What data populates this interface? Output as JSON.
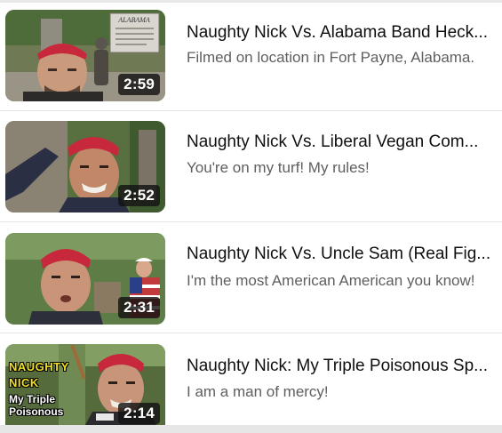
{
  "videos": [
    {
      "title": "Naughty Nick Vs. Alabama Band Heck...",
      "description": "Filmed on location in Fort Payne, Alabama.",
      "duration": "2:59",
      "thumb_sign": "ALABAMA"
    },
    {
      "title": "Naughty Nick Vs. Liberal Vegan Com...",
      "description": "You're on my turf! My rules!",
      "duration": "2:52"
    },
    {
      "title": "Naughty Nick Vs. Uncle Sam (Real Fig...",
      "description": "I'm the most American American you know!",
      "duration": "2:31"
    },
    {
      "title": "Naughty Nick: My Triple Poisonous Sp...",
      "description": "I am a man of mercy!",
      "duration": "2:14",
      "thumb_overlay": {
        "line1": "NAUGHTY",
        "line2": "NICK",
        "line3": "My Triple",
        "line4": "Poisonous"
      }
    }
  ],
  "colors": {
    "bandana": "#c8283c",
    "title": "#0f0f0f",
    "description": "#5f5f5f"
  }
}
